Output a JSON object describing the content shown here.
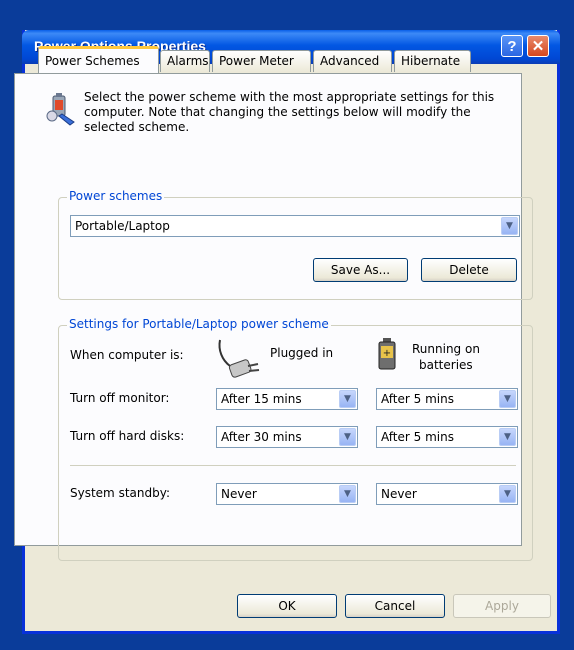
{
  "window": {
    "title": "Power Options Properties"
  },
  "tabs": [
    {
      "label": "Power Schemes",
      "active": true
    },
    {
      "label": "Alarms"
    },
    {
      "label": "Power Meter"
    },
    {
      "label": "Advanced"
    },
    {
      "label": "Hibernate"
    }
  ],
  "intro": "Select the power scheme with the most appropriate settings for this computer. Note that changing the settings below will modify the selected scheme.",
  "power_schemes": {
    "legend": "Power schemes",
    "selected": "Portable/Laptop",
    "save_as_label": "Save As...",
    "delete_label": "Delete"
  },
  "settings": {
    "legend": "Settings for Portable/Laptop power scheme",
    "when_label": "When computer is:",
    "plugged_label": "Plugged in",
    "battery_label_line1": "Running on",
    "battery_label_line2": "batteries",
    "rows": [
      {
        "label": "Turn off monitor:",
        "plugged": "After 15 mins",
        "battery": "After 5 mins"
      },
      {
        "label": "Turn off hard disks:",
        "plugged": "After 30 mins",
        "battery": "After 5 mins"
      },
      {
        "label": "System standby:",
        "plugged": "Never",
        "battery": "Never"
      }
    ]
  },
  "buttons": {
    "ok": "OK",
    "cancel": "Cancel",
    "apply": "Apply"
  },
  "colors": {
    "accent": "#0046d5",
    "titlebar": "#0257e3",
    "dialog_bg": "#ece9d8"
  }
}
